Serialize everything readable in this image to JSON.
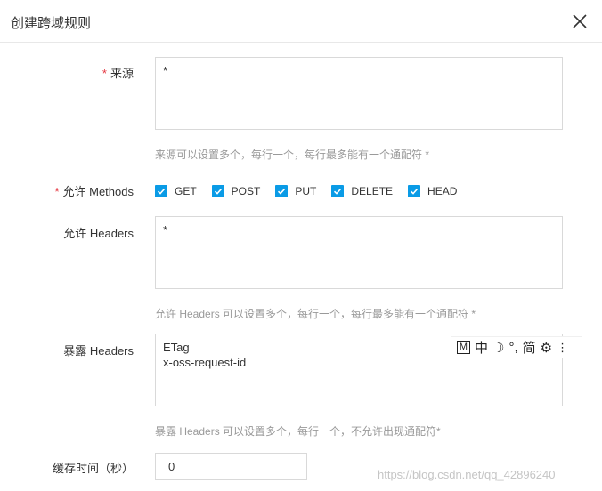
{
  "dialog": {
    "title": "创建跨域规则"
  },
  "form": {
    "required_mark": "*",
    "origin": {
      "label": "来源",
      "value": "*",
      "hint": "来源可以设置多个，每行一个，每行最多能有一个通配符 *"
    },
    "methods": {
      "label": "允许 Methods",
      "options": [
        {
          "label": "GET",
          "checked": true
        },
        {
          "label": "POST",
          "checked": true
        },
        {
          "label": "PUT",
          "checked": true
        },
        {
          "label": "DELETE",
          "checked": true
        },
        {
          "label": "HEAD",
          "checked": true
        }
      ]
    },
    "allow_headers": {
      "label": "允许 Headers",
      "value": "*",
      "hint": "允许 Headers 可以设置多个，每行一个，每行最多能有一个通配符 *"
    },
    "expose_headers": {
      "label": "暴露 Headers",
      "value": "ETag\nx-oss-request-id",
      "hint": "暴露 Headers 可以设置多个，每行一个，不允许出现通配符*"
    },
    "cache_time": {
      "label": "缓存时间（秒）",
      "value": "0"
    }
  },
  "ime_toolbar": {
    "mode_box": "M",
    "lang": "中",
    "moon": "☽",
    "punct": "°,",
    "simplified": "简",
    "gear": "⚙",
    "more": "⋮"
  },
  "watermark": "https://blog.csdn.net/qq_42896240",
  "colors": {
    "accent": "#0a9be6",
    "required": "#e5353f",
    "hint": "#999999"
  }
}
